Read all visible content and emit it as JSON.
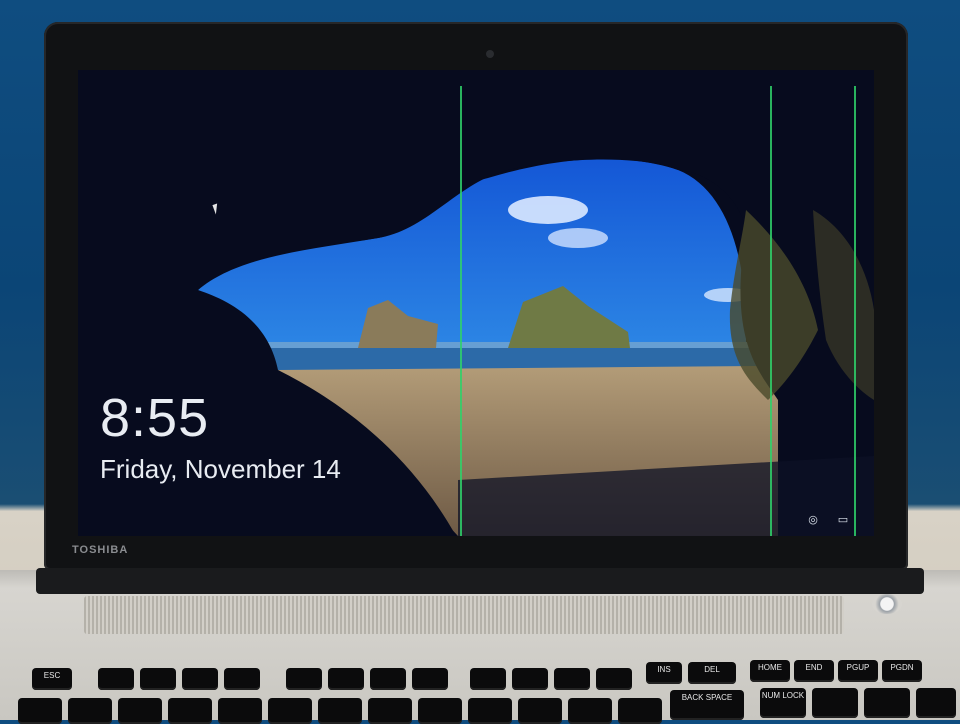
{
  "laptop": {
    "brand": "TOSHIBA",
    "status_icons": [
      "network-icon",
      "battery-icon"
    ]
  },
  "lock_screen": {
    "time": "8:55",
    "date": "Friday, November 14"
  },
  "keyboard": {
    "function_row": [
      "ESC",
      "",
      "",
      "",
      "",
      "",
      "",
      "",
      "",
      "",
      "",
      "",
      "",
      "",
      "INS",
      "DEL",
      "HOME",
      "END",
      "PGUP",
      "PGDN"
    ],
    "number_row": [
      "",
      "",
      "",
      "",
      "",
      "",
      "",
      "",
      "",
      "",
      "",
      "",
      "",
      "",
      "BACK SPACE",
      "NUM LOCK",
      "",
      "",
      ""
    ]
  },
  "colors": {
    "screen_dark": "#070b1e",
    "sky": "#1f6fd8",
    "sea": "#2c6aa8",
    "sand": "#9c8a6c",
    "dead_pixel_line": "#2fd16a",
    "bezel": "#111214",
    "wall": "#0f4d80"
  }
}
